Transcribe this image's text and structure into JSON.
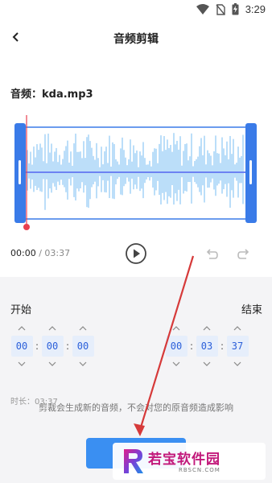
{
  "status_bar": {
    "time": "3:29",
    "icons": [
      "wifi-icon",
      "no-sim-icon",
      "battery-charging-icon"
    ]
  },
  "header": {
    "back_icon": "chevron-left-icon",
    "title": "音频剪辑"
  },
  "file": {
    "label": "音频：kda.mp3"
  },
  "waveform": {
    "colors": {
      "wave": "#8ec8f5",
      "frame": "#3a7be8",
      "handle": "#3a7be8",
      "playhead": "#e8404f",
      "center_line": "#6d83f2"
    }
  },
  "playback": {
    "current_time": "00:00",
    "separator": " / ",
    "total_time": "03:37",
    "play_icon": "play-circle-icon",
    "undo_icon": "undo-icon",
    "redo_icon": "redo-icon"
  },
  "trim": {
    "start_label": "开始",
    "end_label": "结束",
    "start": {
      "h": "00",
      "m": "00",
      "s": "00"
    },
    "end": {
      "h": "00",
      "m": "03",
      "s": "37"
    },
    "colon": ":",
    "duration_label": "时长：03:37",
    "notice": "剪裁会生成新的音频，不会对您的原音频造成影响"
  },
  "save_button": {
    "color": "#3a8ff2"
  },
  "watermark": {
    "text": "若宝软件园",
    "subtext": "RBSCN.COM"
  }
}
